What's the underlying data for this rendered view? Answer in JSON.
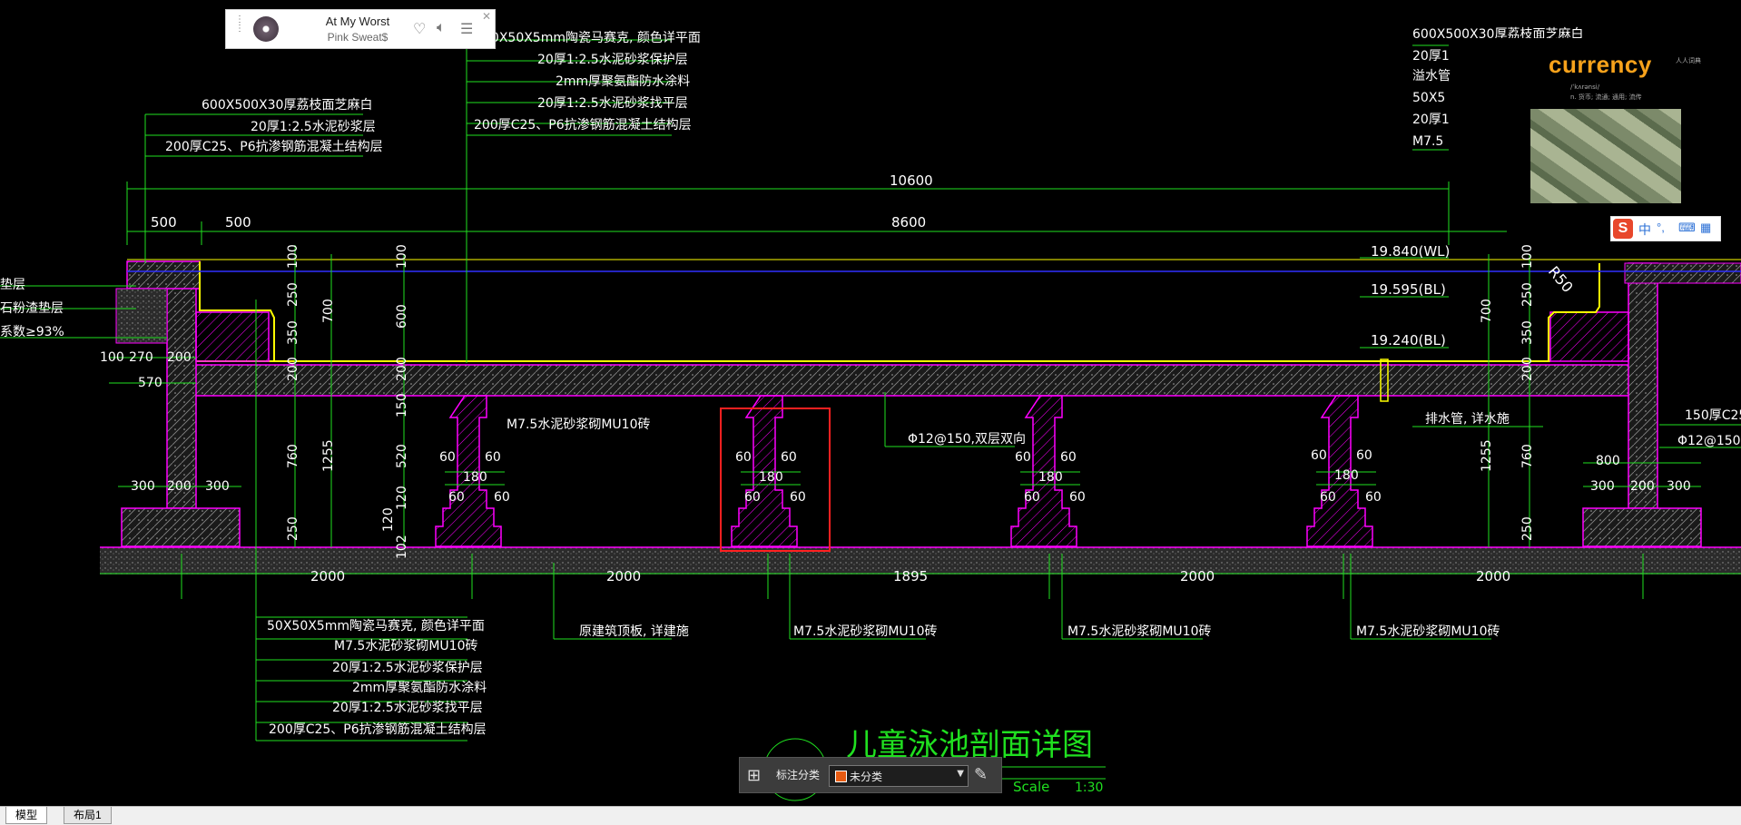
{
  "player": {
    "title": "At My Worst",
    "artist": "Pink Sweat$",
    "close_glyph": "✕",
    "grip_glyph": "⋮",
    "icons": [
      "heart-icon",
      "volume-icon",
      "playlist-icon"
    ]
  },
  "ad": {
    "word": "currency",
    "line1": "/ˈkʌrənsi/",
    "line2": "n. 货币; 流通; 通用; 流传",
    "corner_text": "人人词典"
  },
  "ime": {
    "brand": "S",
    "lang": "中",
    "punct": "°,",
    "icons": [
      "keyboard-icon",
      "toolbox-icon"
    ]
  },
  "annotation_bar": {
    "label": "标注分类",
    "selected": "未分类",
    "swatch_color": "#e85b12"
  },
  "tabs": {
    "model": "模型",
    "layout1": "布局1"
  },
  "drawing": {
    "title": "儿童泳池剖面详图",
    "scale_label": "Scale",
    "scale_value": "1:30",
    "overall_dims": {
      "total": "10600",
      "inner": "8600",
      "left1": "500",
      "left2": "500"
    },
    "levels": {
      "wl": "19.840(WL)",
      "bl1": "19.595(BL)",
      "bl2": "19.240(BL)"
    },
    "radius": "R50",
    "top_left_callout": [
      "600X500X30厚荔枝面芝麻白",
      "20厚1:2.5水泥砂浆层",
      "200厚C25、P6抗渗钢筋混凝土结构层"
    ],
    "top_mid_callout": [
      "50X50X5mm陶瓷马赛克, 颜色详平面",
      "20厚1:2.5水泥砂浆保护层",
      "2mm厚聚氨酯防水涂料",
      "20厚1:2.5水泥砂浆找平层",
      "200厚C25、P6抗渗钢筋混凝土结构层"
    ],
    "top_right_callout": [
      "600X500X30厚荔枝面芝麻白",
      "20厚1",
      "溢水管",
      "50X5",
      "20厚1",
      "M7.5"
    ],
    "bottom_left_callout": [
      "50X50X5mm陶瓷马赛克, 颜色详平面",
      "M7.5水泥砂浆砌MU10砖",
      "20厚1:2.5水泥砂浆保护层",
      "2mm厚聚氨酯防水涂料",
      "20厚1:2.5水泥砂浆找平层",
      "200厚C25、P6抗渗钢筋混凝土结构层"
    ],
    "left_edge_labels": [
      "垫层",
      "石粉渣垫层",
      "系数≥93%"
    ],
    "left_dims": {
      "d100": "100",
      "d270": "270",
      "d200": "200",
      "d570": "570",
      "d300a": "300",
      "d200b": "200",
      "d300b": "300"
    },
    "vertical_dims_left": [
      "100",
      "250",
      "350",
      "200",
      "700",
      "760",
      "1255",
      "250",
      "100",
      "600",
      "200",
      "150",
      "520",
      "120",
      "120",
      "102"
    ],
    "vertical_dims_right": [
      "100",
      "250",
      "350",
      "200",
      "700",
      "760",
      "1255",
      "250"
    ],
    "pier_dims": {
      "side": "60",
      "mid": "180"
    },
    "brick_note": "M7.5水泥砂浆砌MU10砖",
    "rebar_note": "Φ12@150,双层双向",
    "drain_note": "排水管, 详水施",
    "right_notes": [
      "150厚C25",
      "Φ12@150"
    ],
    "right_dims": {
      "d800": "800",
      "d300a": "300",
      "d200": "200",
      "d300b": "300"
    },
    "bottom_spans": [
      "2000",
      "2000",
      "1895",
      "2000",
      "2000"
    ],
    "bottom_notes": [
      "原建筑顶板, 详建施",
      "M7.5水泥砂浆砌MU10砖",
      "M7.5水泥砂浆砌MU10砖",
      "M7.5水泥砂浆砌MU10砖"
    ]
  },
  "colors": {
    "green": "#20e020",
    "magenta": "#ff00ff",
    "yellow": "#ffff00",
    "red": "#ff2020",
    "blue": "#3030ff",
    "white": "#ffffff"
  }
}
